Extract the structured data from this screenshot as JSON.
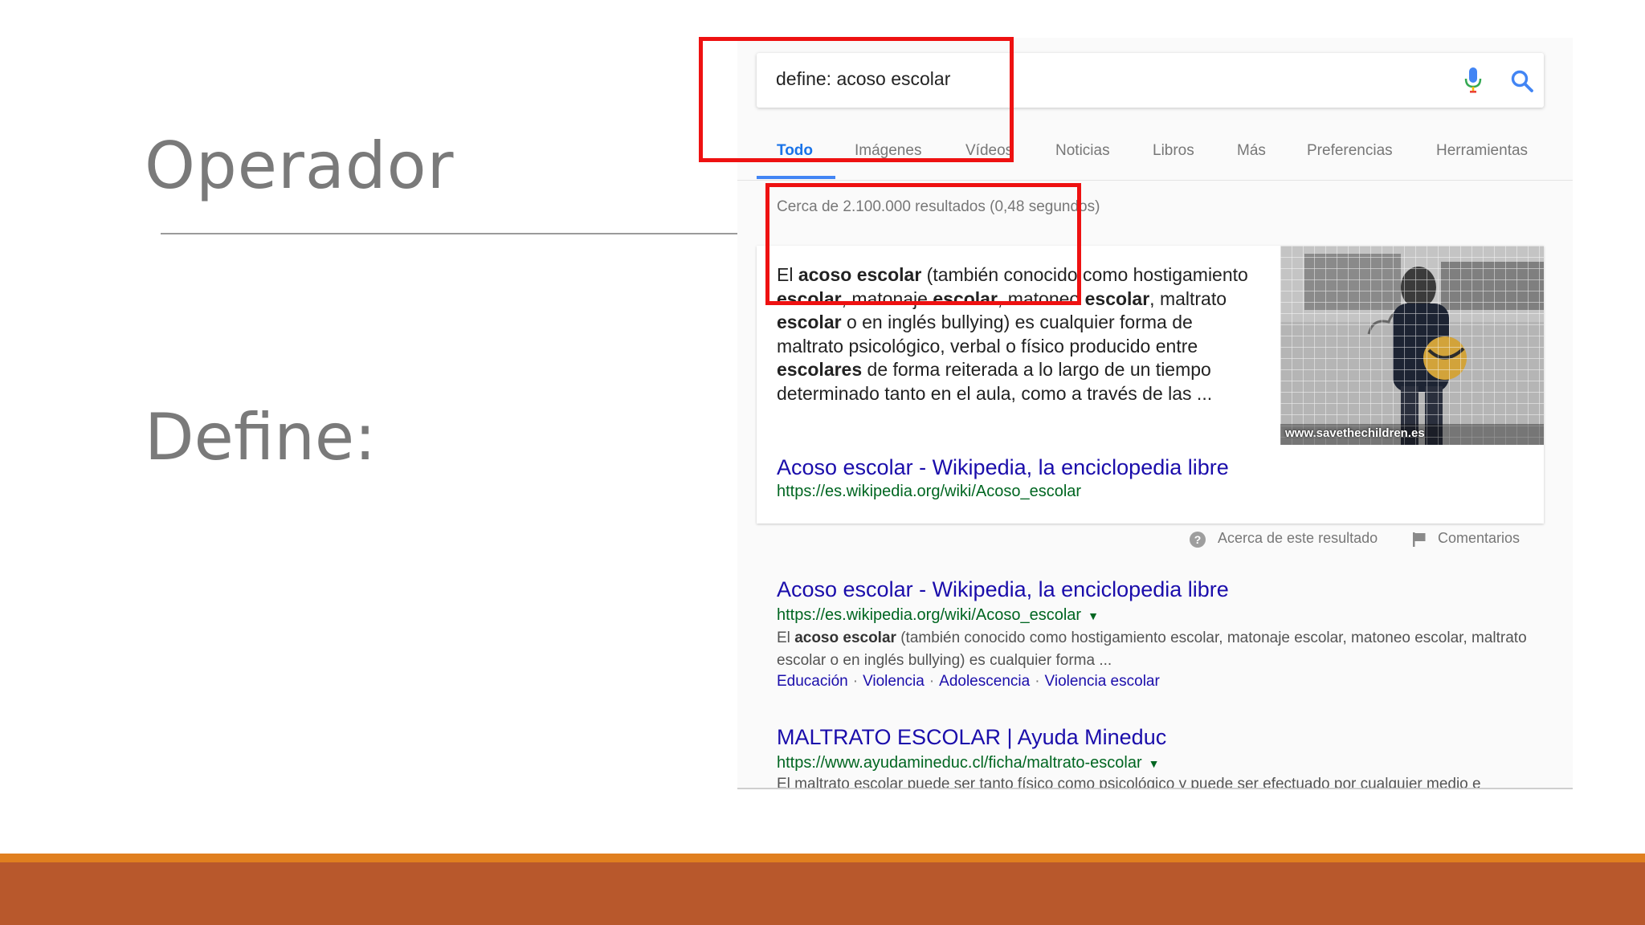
{
  "slide": {
    "title": "Operador",
    "subtitle": "Define:"
  },
  "colors": {
    "accent_orange": "#E07F1F",
    "accent_rust": "#B8582C",
    "annotation_red": "#EE1111",
    "link_blue": "#1A0DAB",
    "url_green": "#006621"
  },
  "search": {
    "query": "define: acoso escolar",
    "mic_icon": "microphone-icon",
    "search_icon": "magnifier-icon"
  },
  "tabs": [
    {
      "label": "Todo",
      "active": true
    },
    {
      "label": "Imágenes"
    },
    {
      "label": "Vídeos"
    },
    {
      "label": "Noticias"
    },
    {
      "label": "Libros"
    },
    {
      "label": "Más"
    },
    {
      "label": "Preferencias"
    },
    {
      "label": "Herramientas"
    }
  ],
  "results_stats": "Cerca de 2.100.000 resultados (0,48 segundos)",
  "featured": {
    "snippet_html": "El <b>acoso escolar</b> (también conocido como hostigamiento <b>escolar</b>, matonaje <b>escolar</b>, matoneo <b>escolar</b>, maltrato <b>escolar</b> o en inglés bullying) es cualquier forma de maltrato psicológico, verbal o físico producido entre <b>escolares</b> de forma reiterada a lo largo de un tiempo determinado tanto en el aula, como a través de las ...",
    "image_caption": "www.savethechildren.es",
    "link_title": "Acoso escolar - Wikipedia, la enciclopedia libre",
    "link_url": "https://es.wikipedia.org/wiki/Acoso_escolar",
    "about_label": "Acerca de este resultado",
    "feedback_label": "Comentarios"
  },
  "results": [
    {
      "title": "Acoso escolar - Wikipedia, la enciclopedia libre",
      "url": "https://es.wikipedia.org/wiki/Acoso_escolar",
      "snippet_html": "El <b>acoso escolar</b> (también conocido como hostigamiento escolar, matonaje escolar, matoneo escolar, maltrato escolar o en inglés bullying) es cualquier forma ...",
      "sitelinks": [
        "Educación",
        "Violencia",
        "Adolescencia",
        "Violencia escolar"
      ]
    },
    {
      "title": "MALTRATO ESCOLAR | Ayuda Mineduc",
      "url": "https://www.ayudamineduc.cl/ficha/maltrato-escolar",
      "snippet_cut": "El maltrato escolar puede ser tanto físico como psicológico y puede ser efectuado por cualquier medio e"
    }
  ]
}
